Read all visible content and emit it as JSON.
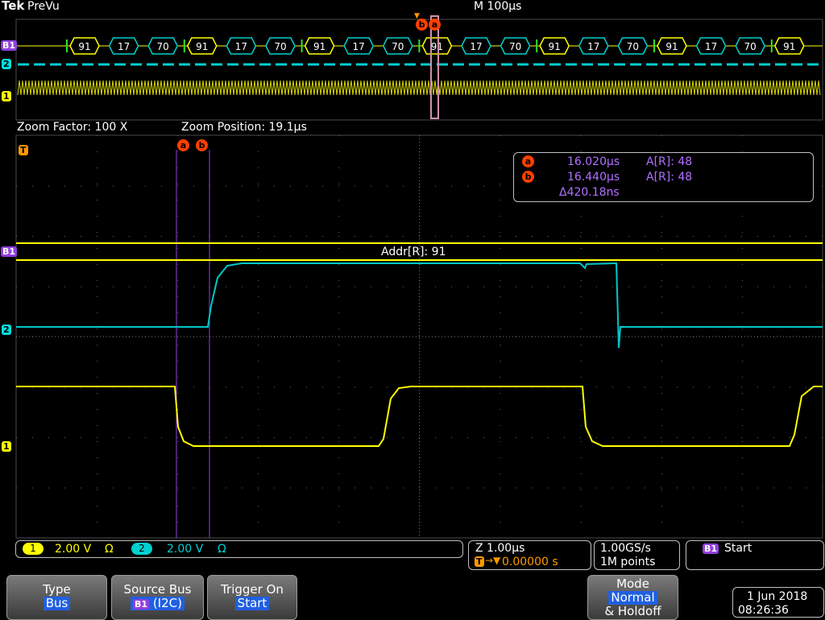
{
  "header": {
    "brand": "Tek",
    "mode": "PreVu",
    "timebase": "M 100µs"
  },
  "overview": {
    "bus_marker": "B1",
    "ch2_marker": "2",
    "ch1_marker": "1",
    "packets": [
      "91",
      "17",
      "70",
      "91",
      "17",
      "70",
      "91",
      "17",
      "70",
      "91",
      "17",
      "70",
      "91",
      "17",
      "70",
      "91",
      "17",
      "70",
      "91"
    ],
    "trigger_glyph": "T",
    "cursor_b": "b",
    "cursor_a": "a"
  },
  "zoom": {
    "factor": "Zoom Factor: 100 X",
    "position": "Zoom Position: 19.1µs"
  },
  "main": {
    "trigger_marker": "T",
    "cursor_a": "a",
    "cursor_b": "b",
    "bus_marker": "B1",
    "ch2_marker": "2",
    "ch1_marker": "1",
    "bus_decode": "Addr[R]: 91"
  },
  "cursor_readout": {
    "a_label": "a",
    "a_time": "16.020µs",
    "a_value": "A[R]: 48",
    "b_label": "b",
    "b_time": "16.440µs",
    "b_value": "A[R]: 48",
    "delta": "Δ420.18ns"
  },
  "status": {
    "ch1_num": "1",
    "ch1_scale": "2.00 V",
    "ch1_term": "Ω",
    "ch2_num": "2",
    "ch2_scale": "2.00 V",
    "ch2_term": "Ω",
    "zoom_scale": "Z 1.00µs",
    "trigger_icon": "T",
    "trigger_pos": "0.00000 s",
    "sample_rate": "1.00GS/s",
    "record_len": "1M points",
    "bus_badge": "B1",
    "trigger_state": "Start"
  },
  "menu": {
    "type_label": "Type",
    "type_value": "Bus",
    "source_label": "Source Bus",
    "source_badge": "B1",
    "source_value": "(I2C)",
    "trigger_on_label": "Trigger On",
    "trigger_on_value": "Start",
    "mode_label": "Mode",
    "mode_value": "Normal",
    "mode_sub": "& Holdoff"
  },
  "datetime": {
    "date": "1 Jun 2018",
    "time": "08:26:36"
  },
  "colors": {
    "ch1": "#ffff00",
    "ch2": "#00d0d0",
    "bus": "#9040e0",
    "cursor": "#ff4000",
    "readout_text": "#b070ff",
    "trigger": "#ff9900",
    "highlight": "#2060e0"
  }
}
